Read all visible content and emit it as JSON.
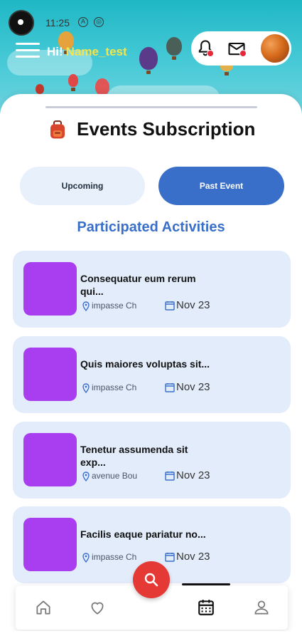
{
  "status_bar": {
    "time": "11:25",
    "icon_a": "A",
    "icon_b": "◎"
  },
  "header": {
    "greeting": "Hi!",
    "username": "Name_test"
  },
  "page": {
    "title": "Events Subscription",
    "tabs": [
      {
        "label": "Upcoming",
        "active": false
      },
      {
        "label": "Past  Event",
        "active": true
      }
    ],
    "section_title": "Participated Activities"
  },
  "events": [
    {
      "title": "Consequatur eum rerum qui...",
      "location": "impasse Ch",
      "date": "Nov 23"
    },
    {
      "title": "Quis maiores voluptas sit...",
      "location": "impasse Ch",
      "date": "Nov 23"
    },
    {
      "title": "Tenetur assumenda sit exp...",
      "location": "avenue Bou",
      "date": "Nov 23"
    },
    {
      "title": "Facilis eaque pariatur no...",
      "location": "impasse Ch",
      "date": "Nov 23"
    }
  ],
  "colors": {
    "accent": "#3a6fc9",
    "card_bg": "#e3ecfb",
    "thumb": "#a93df0",
    "fab": "#e53935",
    "username": "#f7e34a"
  },
  "icons": {
    "menu": "hamburger-menu-icon",
    "notifications": "bell-icon",
    "messages": "mail-icon",
    "location": "location-pin-icon",
    "date": "calendar-icon",
    "search": "search-icon",
    "nav": [
      "home-icon",
      "heart-icon",
      "calendar-icon",
      "person-icon"
    ]
  }
}
